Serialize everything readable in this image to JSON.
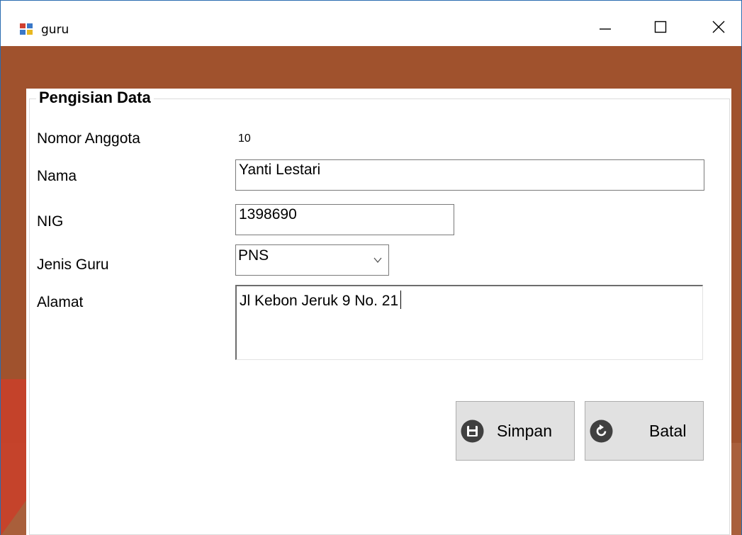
{
  "window": {
    "title": "guru",
    "minimize_glyph": "—",
    "maximize_glyph": "☐",
    "close_glyph": "✕"
  },
  "form": {
    "group_title": "Pengisian Data",
    "nomor_anggota": {
      "label": "Nomor Anggota",
      "value": "10"
    },
    "nama": {
      "label": "Nama",
      "value": "Yanti Lestari"
    },
    "nig": {
      "label": "NIG",
      "value": "1398690"
    },
    "jenis_guru": {
      "label": "Jenis Guru",
      "selected": "PNS"
    },
    "alamat": {
      "label": "Alamat",
      "value": "Jl Kebon Jeruk 9 No. 21"
    }
  },
  "buttons": {
    "simpan": {
      "label": "Simpan",
      "icon": "save-icon"
    },
    "batal": {
      "label": "Batal",
      "icon": "refresh-icon"
    }
  },
  "colors": {
    "client_background": "#a0522d",
    "decoration_red": "#c8402a",
    "decoration_gray": "#9a9a9a",
    "button_face": "#e1e1e1",
    "button_icon": "#404040"
  }
}
